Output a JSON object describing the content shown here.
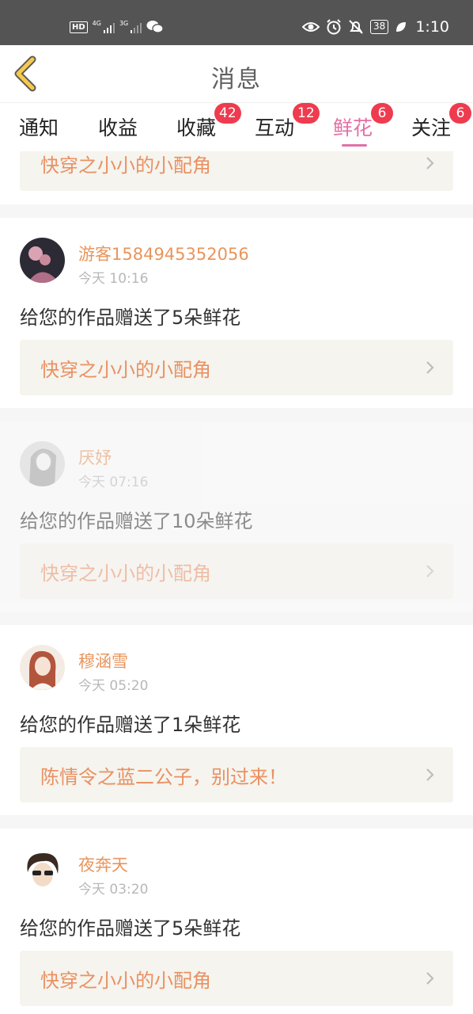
{
  "status_bar": {
    "hd": "HD",
    "net1": "4G",
    "net2": "3G",
    "battery": "38",
    "time": "1:10"
  },
  "header": {
    "title": "消息"
  },
  "tabs": [
    {
      "label": "通知",
      "badge": ""
    },
    {
      "label": "收益",
      "badge": ""
    },
    {
      "label": "收藏",
      "badge": "42"
    },
    {
      "label": "互动",
      "badge": "12"
    },
    {
      "label": "鲜花",
      "badge": "6",
      "active": true
    },
    {
      "label": "关注",
      "badge": "6"
    }
  ],
  "colors": {
    "accent_pink": "#e46fa5",
    "name_orange": "#e8955c",
    "badge_red": "#ef3b4f"
  },
  "messages": [
    {
      "work_title": "快穿之小小的小配角"
    },
    {
      "name": "游客1584945352056",
      "time": "今天 10:16",
      "text": "给您的作品赠送了5朵鲜花",
      "work_title": "快穿之小小的小配角"
    },
    {
      "name": "厌妤",
      "time": "今天 07:16",
      "text": "给您的作品赠送了10朵鲜花",
      "work_title": "快穿之小小的小配角"
    },
    {
      "name": "穆涵雪",
      "time": "今天 05:20",
      "text": "给您的作品赠送了1朵鲜花",
      "work_title": "陈情令之蓝二公子，别过来！"
    },
    {
      "name": "夜奔天",
      "time": "今天 03:20",
      "text": "给您的作品赠送了5朵鲜花",
      "work_title": "快穿之小小的小配角"
    }
  ]
}
